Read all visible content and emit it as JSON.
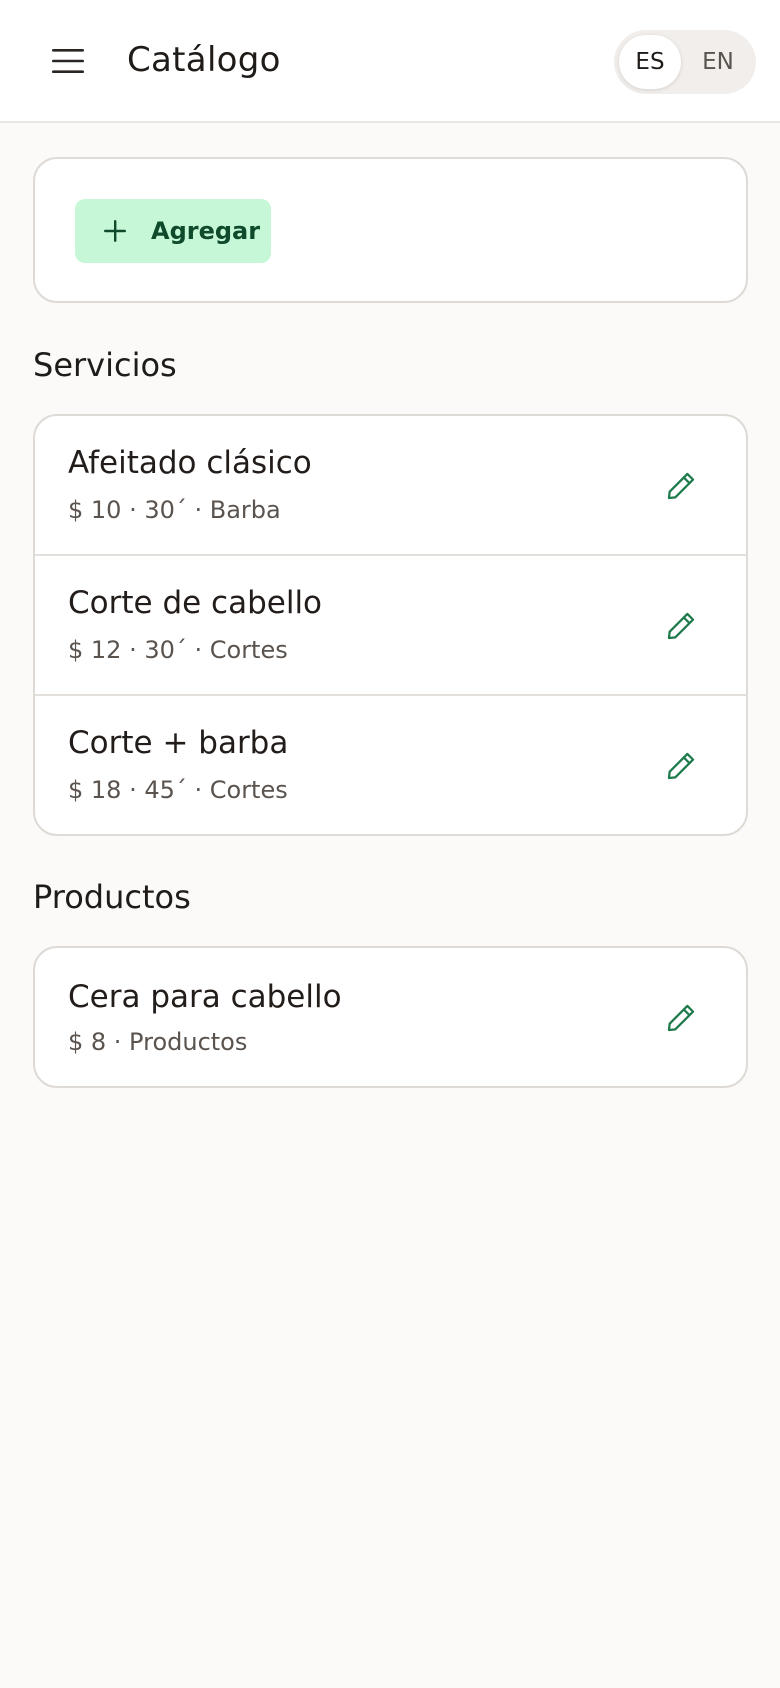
{
  "header": {
    "title": "Catálogo",
    "menu_icon": "hamburger-menu-icon",
    "languages": [
      {
        "code": "ES",
        "active": true
      },
      {
        "code": "EN",
        "active": false
      }
    ]
  },
  "add": {
    "label": "Agregar",
    "icon": "plus-icon"
  },
  "sections": [
    {
      "title": "Servicios",
      "items": [
        {
          "name": "Afeitado clásico",
          "details": "$ 10 · 30´ · Barba"
        },
        {
          "name": "Corte de cabello",
          "details": "$ 12 · 30´ · Cortes"
        },
        {
          "name": "Corte + barba",
          "details": "$ 18 · 45´ · Cortes"
        }
      ]
    },
    {
      "title": "Productos",
      "items": [
        {
          "name": "Cera para cabello",
          "details": "$ 8 · Productos"
        }
      ]
    }
  ],
  "colors": {
    "accent": "#1d7a4a",
    "add_button_bg": "#c6f8d8",
    "add_button_text": "#0e4a2b",
    "background": "#fcfaf8"
  }
}
